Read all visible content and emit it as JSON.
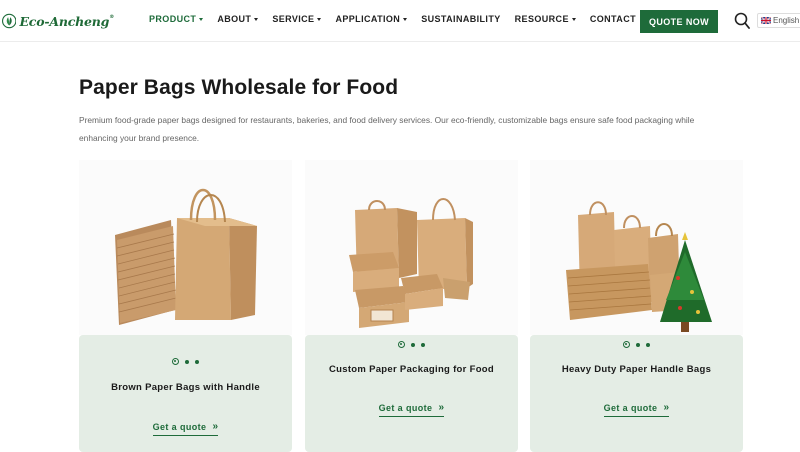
{
  "brand": {
    "name": "Eco-Ancheng",
    "reg": "®",
    "color": "#1e6b3a"
  },
  "nav": {
    "items": [
      {
        "label": "PRODUCT",
        "dropdown": true,
        "active": true
      },
      {
        "label": "ABOUT",
        "dropdown": true,
        "active": false
      },
      {
        "label": "SERVICE",
        "dropdown": true,
        "active": false
      },
      {
        "label": "APPLICATION",
        "dropdown": true,
        "active": false
      },
      {
        "label": "SUSTAINABILITY",
        "dropdown": false,
        "active": false
      },
      {
        "label": "RESOURCE",
        "dropdown": true,
        "active": false
      },
      {
        "label": "CONTACT",
        "dropdown": false,
        "active": false
      }
    ],
    "quote_button": "QUOTE NOW",
    "search_icon": "search-icon",
    "language": "English"
  },
  "main": {
    "title": "Paper Bags Wholesale for Food",
    "description": "Premium food-grade paper bags designed for restaurants, bakeries, and food delivery services. Our eco-friendly, customizable bags ensure safe food packaging while enhancing your brand presence."
  },
  "cards": [
    {
      "title": "Brown Paper Bags with Handle",
      "link": "Get a quote",
      "image": "kraft-bag-stack-image"
    },
    {
      "title": "Custom Paper Packaging for Food",
      "link": "Get a quote",
      "image": "food-packaging-set-image"
    },
    {
      "title": "Heavy Duty Paper Handle Bags",
      "link": "Get a quote",
      "image": "handle-bags-christmas-tree-image"
    }
  ]
}
